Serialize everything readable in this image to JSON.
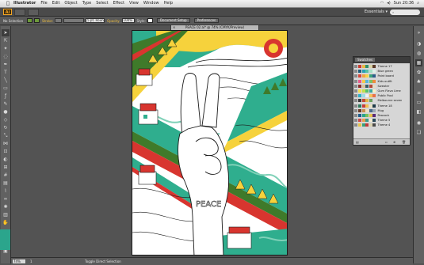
{
  "menubar": {
    "apple": "",
    "app_name": "Illustrator",
    "menus": [
      "File",
      "Edit",
      "Object",
      "Type",
      "Select",
      "Effect",
      "View",
      "Window",
      "Help"
    ],
    "clock": "Sun 20:36"
  },
  "appbar": {
    "logo": "Ai",
    "workspace": "Essentials ▾"
  },
  "control": {
    "selection_label": "No Selection",
    "stroke_label": "Stroke:",
    "brush_value": "5 pt. Round",
    "opacity_label": "Opacity:",
    "opacity_value": "100%",
    "style_label": "Style:",
    "document_setup": "Document Setup",
    "preferences": "Preferences"
  },
  "document": {
    "tab_title": "PEACE 02.ai* @ 74% (CMYK/Preview)",
    "artwork_text": "PEACE"
  },
  "swatches_panel": {
    "tab_label": "Swatches",
    "rows": [
      {
        "name": "Theme 17",
        "colors": [
          "#c93c30",
          "#e8b844",
          "#2f8f6e",
          "#d9d3a8",
          "#5a3a2a"
        ]
      },
      {
        "name": "Blue green",
        "colors": [
          "#1f5c7a",
          "#2a9fb5",
          "#56c2a6",
          "#a7e0c8",
          "#e0f2e8"
        ]
      },
      {
        "name": "Paint board",
        "colors": [
          "#d6473a",
          "#f2a541",
          "#f5d547",
          "#3aa27a",
          "#2d5d8a"
        ]
      },
      {
        "name": "Kids outfit",
        "colors": [
          "#e85a8c",
          "#f7c948",
          "#58b4e0",
          "#7ac36a",
          "#f08a3c"
        ]
      },
      {
        "name": "Sweater",
        "colors": [
          "#8c2f2f",
          "#d9c29a",
          "#365e6b",
          "#b04a3a",
          "#e6dcc6"
        ]
      },
      {
        "name": "Gum Flavo Lime",
        "colors": [
          "#f4e04d",
          "#c2e04d",
          "#58c26a",
          "#3aa8a0",
          "#f7f2c4"
        ]
      },
      {
        "name": "Public Pool",
        "colors": [
          "#2cb0c8",
          "#9fdde8",
          "#f2f2f2",
          "#f5c15a",
          "#e86f4b"
        ]
      },
      {
        "name": "Melbourne seven",
        "colors": [
          "#3a3a3a",
          "#c24a3a",
          "#e0b84a",
          "#6a9f5a",
          "#d9d9d9"
        ]
      },
      {
        "name": "Theme 18",
        "colors": [
          "#2d7a5c",
          "#c43d3d",
          "#f3c14b",
          "#e8e2c4",
          "#1e3a4a"
        ]
      },
      {
        "name": "Mug",
        "colors": [
          "#6b3d2a",
          "#c98d4e",
          "#efe0c2",
          "#4a6a8a",
          "#9aa8b4"
        ]
      },
      {
        "name": "Peacock",
        "colors": [
          "#1d5c8c",
          "#2aa48c",
          "#7ac25a",
          "#e8c24a",
          "#5a2a7a"
        ]
      },
      {
        "name": "Theme 5",
        "colors": [
          "#c94a4a",
          "#e8a04a",
          "#3a9a8a",
          "#f2ead2",
          "#2a4a5a"
        ]
      },
      {
        "name": "Theme 4",
        "colors": [
          "#e8c44a",
          "#3aa07a",
          "#c23a3a",
          "#d9d2b0",
          "#4a4a4a"
        ]
      }
    ],
    "footer_icons": [
      "library-icon",
      "swatch-menu-icon",
      "new-group-icon",
      "new-swatch-icon",
      "delete-swatch-icon"
    ]
  },
  "status": {
    "zoom": "74%",
    "page": "1",
    "tool_hint": "Toggle Direct Selection"
  },
  "colors": {
    "teal": "#2fae8e",
    "yellow": "#f6d23c",
    "red": "#d8352f",
    "green": "#3f7a2a",
    "pale_teal": "#7fd1b8"
  }
}
